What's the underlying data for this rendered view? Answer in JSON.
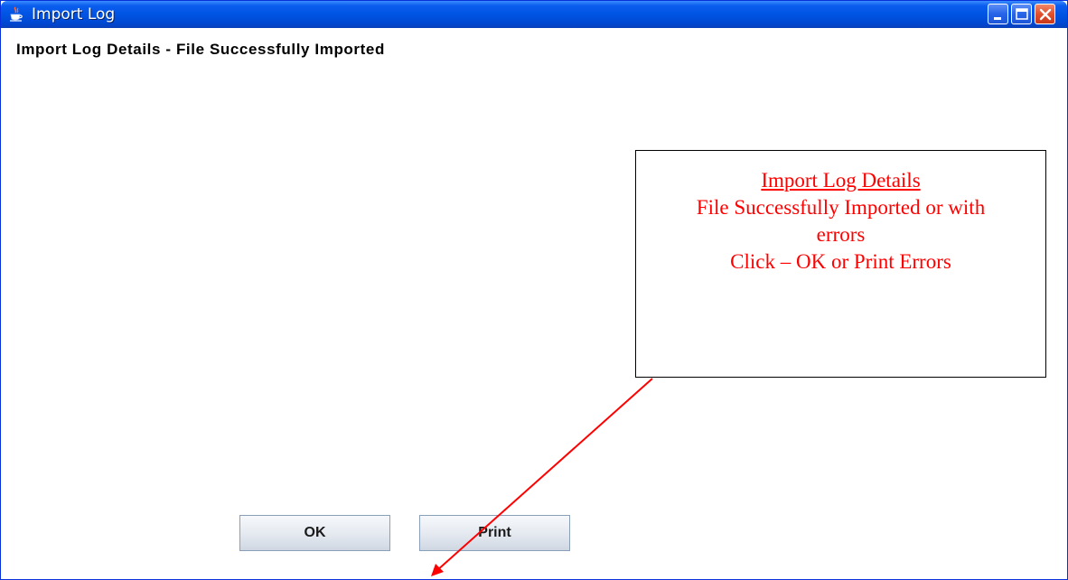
{
  "window": {
    "title": "Import Log",
    "controls": [
      "minimize",
      "maximize",
      "close"
    ],
    "app_icon": "java-cup-icon"
  },
  "main": {
    "heading": "Import Log Details - File Successfully Imported"
  },
  "buttons": {
    "ok_label": "OK",
    "print_label": "Print"
  },
  "callout": {
    "title": "Import Log Details",
    "line2": "File Successfully Imported or with errors",
    "line3": "Click – OK or Print Errors"
  },
  "colors": {
    "titlebar": "#0054e3",
    "annotation": "#ff0000",
    "close_button": "#e0502c"
  }
}
